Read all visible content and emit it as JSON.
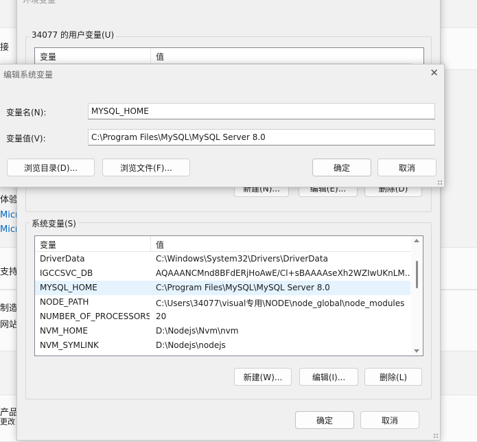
{
  "background": {
    "fragments": [
      "接",
      "体验",
      "Micr",
      "Micr",
      "支持",
      "制造",
      "网站",
      "产品",
      "更改"
    ]
  },
  "env_window": {
    "title": "环境变量",
    "user_group_label": "34077 的用户变量(U)",
    "user_list": {
      "col_name": "变量",
      "col_value": "值"
    },
    "user_buttons": {
      "new": "新建(N)...",
      "edit": "编辑(E)...",
      "delete": "删除(D)"
    },
    "system_group_label": "系统变量(S)",
    "system_list": {
      "col_name": "变量",
      "col_value": "值",
      "rows": [
        {
          "name": "DriverData",
          "value": "C:\\Windows\\System32\\Drivers\\DriverData"
        },
        {
          "name": "IGCCSVC_DB",
          "value": "AQAAANCMnd8BFdERjHoAwE/Cl+sBAAAAseXh2WZIwUKnLM..."
        },
        {
          "name": "MYSQL_HOME",
          "value": "C:\\Program Files\\MySQL\\MySQL Server 8.0"
        },
        {
          "name": "NODE_PATH",
          "value": "C:\\Users\\34077\\visual专用\\NODE\\node_global\\node_modules"
        },
        {
          "name": "NUMBER_OF_PROCESSORS",
          "value": "20"
        },
        {
          "name": "NVM_HOME",
          "value": "D:\\Nodejs\\Nvm\\nvm"
        },
        {
          "name": "NVM_SYMLINK",
          "value": "D:\\Nodejs\\nodejs"
        }
      ],
      "selected_index": 2
    },
    "system_buttons": {
      "new": "新建(W)...",
      "edit": "编辑(I)...",
      "delete": "删除(L)"
    },
    "ok": "确定",
    "cancel": "取消"
  },
  "edit_dialog": {
    "title": "编辑系统变量",
    "name_label": "变量名(N):",
    "name_value": "MYSQL_HOME",
    "value_label": "变量值(V):",
    "value_value": "C:\\Program Files\\MySQL\\MySQL Server 8.0",
    "browse_dir": "浏览目录(D)...",
    "browse_file": "浏览文件(F)...",
    "ok": "确定",
    "cancel": "取消"
  }
}
